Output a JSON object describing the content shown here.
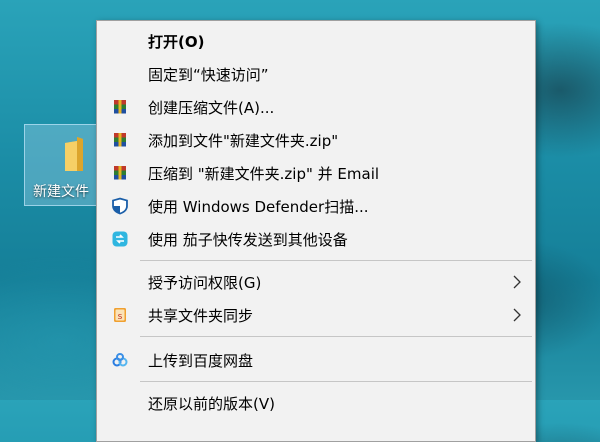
{
  "desktop": {
    "folder_label": "新建文件"
  },
  "menu": {
    "open": "打开(O)",
    "pin_quick_access": "固定到“快速访问”",
    "create_archive": "创建压缩文件(A)...",
    "add_to_archive": "添加到文件\"新建文件夹.zip\"",
    "compress_email": "压缩到 \"新建文件夹.zip\" 并 Email",
    "defender_scan": "使用 Windows Defender扫描...",
    "send_qiezi": "使用 茄子快传发送到其他设备",
    "give_access": "授予访问权限(G)",
    "share_sync": "共享文件夹同步",
    "upload_baidu": "上传到百度网盘",
    "restore_versions": "还原以前的版本(V)"
  },
  "colors": {
    "menu_bg": "#f2f2f2",
    "defender_blue": "#1a5ea8",
    "qiezi_cyan": "#2fb6e0",
    "share_orange": "#f0a030"
  }
}
